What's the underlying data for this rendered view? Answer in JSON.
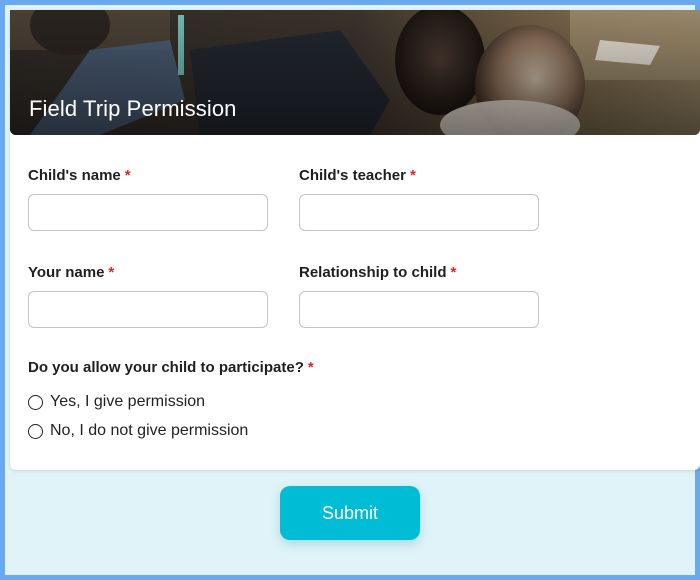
{
  "form": {
    "header_title": "Field Trip Permission",
    "required_marker": "*",
    "fields": [
      {
        "label": "Child's name",
        "value": ""
      },
      {
        "label": "Child's teacher",
        "value": ""
      },
      {
        "label": "Your name",
        "value": ""
      },
      {
        "label": "Relationship to child",
        "value": ""
      }
    ],
    "question": {
      "label": "Do you allow your child to participate?",
      "options": [
        {
          "label": "Yes, I give permission",
          "selected": false
        },
        {
          "label": "No, I do not give permission",
          "selected": false
        }
      ]
    },
    "submit_label": "Submit"
  },
  "colors": {
    "border": "#6aa9f0",
    "page_background": "#dff3f8",
    "required": "#e02424",
    "submit_button": "#00bcd4"
  }
}
